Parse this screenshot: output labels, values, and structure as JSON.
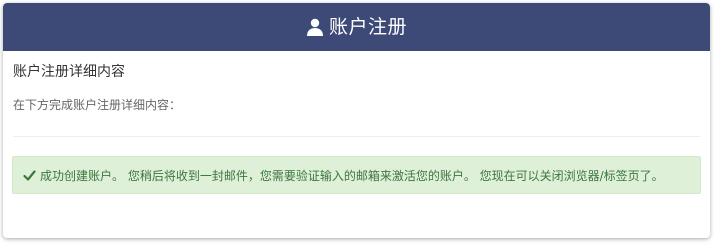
{
  "header": {
    "title": "账户注册",
    "icon": "user-icon",
    "background": "#3d4977"
  },
  "section": {
    "title": "账户注册详细内容",
    "description": "在下方完成账户注册详细内容："
  },
  "alert": {
    "icon": "check-icon",
    "message": "成功创建账户。 您稍后将收到一封邮件，您需要验证输入的邮箱来激活您的账户。 您现在可以关闭浏览器/标签页了。",
    "background": "#dff0d8",
    "text_color": "#3c763d"
  }
}
